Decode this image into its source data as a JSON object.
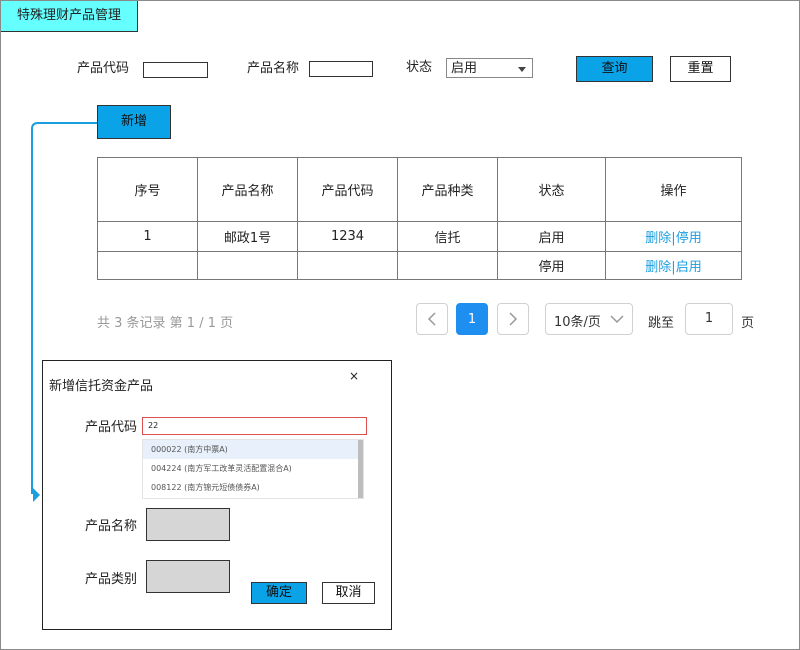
{
  "app": {
    "title": "特殊理财产品管理"
  },
  "search": {
    "code_label": "产品代码",
    "name_label": "产品名称",
    "status_label": "状态",
    "status_value": "启用",
    "query_button": "查询",
    "reset_button": "重置"
  },
  "toolbar": {
    "add_button": "新增"
  },
  "table": {
    "headers": [
      "序号",
      "产品名称",
      "产品代码",
      "产品种类",
      "状态",
      "操作"
    ],
    "rows": [
      {
        "index": "1",
        "name": "邮政1号",
        "code": "1234",
        "type": "信托",
        "status": "启用",
        "action_delete": "删除",
        "action_sep": "|",
        "action_toggle": "停用"
      },
      {
        "index": "",
        "name": "",
        "code": "",
        "type": "",
        "status": "停用",
        "action_delete": "删除",
        "action_sep": "|",
        "action_toggle": "启用"
      }
    ]
  },
  "pagination": {
    "summary": "共 3 条记录 第 1 / 1 页",
    "current_page": "1",
    "page_size": "10条/页",
    "goto_label": "跳至",
    "goto_value": "1",
    "page_suffix": "页"
  },
  "dialog": {
    "title": "新增信托资金产品",
    "close": "×",
    "code_label": "产品代码",
    "code_value": "22",
    "suggestions": [
      "000022 (南方中票A)",
      "004224 (南方军工改革灵活配置混合A)",
      "008122 (南方锦元短债债券A)"
    ],
    "name_label": "产品名称",
    "category_label": "产品类别",
    "confirm_button": "确定",
    "cancel_button": "取消"
  },
  "colors": {
    "title_tab_bg": "#66ffff",
    "primary_button": "#0aa3e8",
    "link": "#1a9ee0",
    "pager_active": "#1e8ff0",
    "connector": "#1a9ee0",
    "error_border": "#e05050"
  },
  "icons": [
    "chevron-down-icon",
    "chevron-left-icon",
    "chevron-right-icon",
    "close-icon",
    "arrow-head-icon"
  ]
}
